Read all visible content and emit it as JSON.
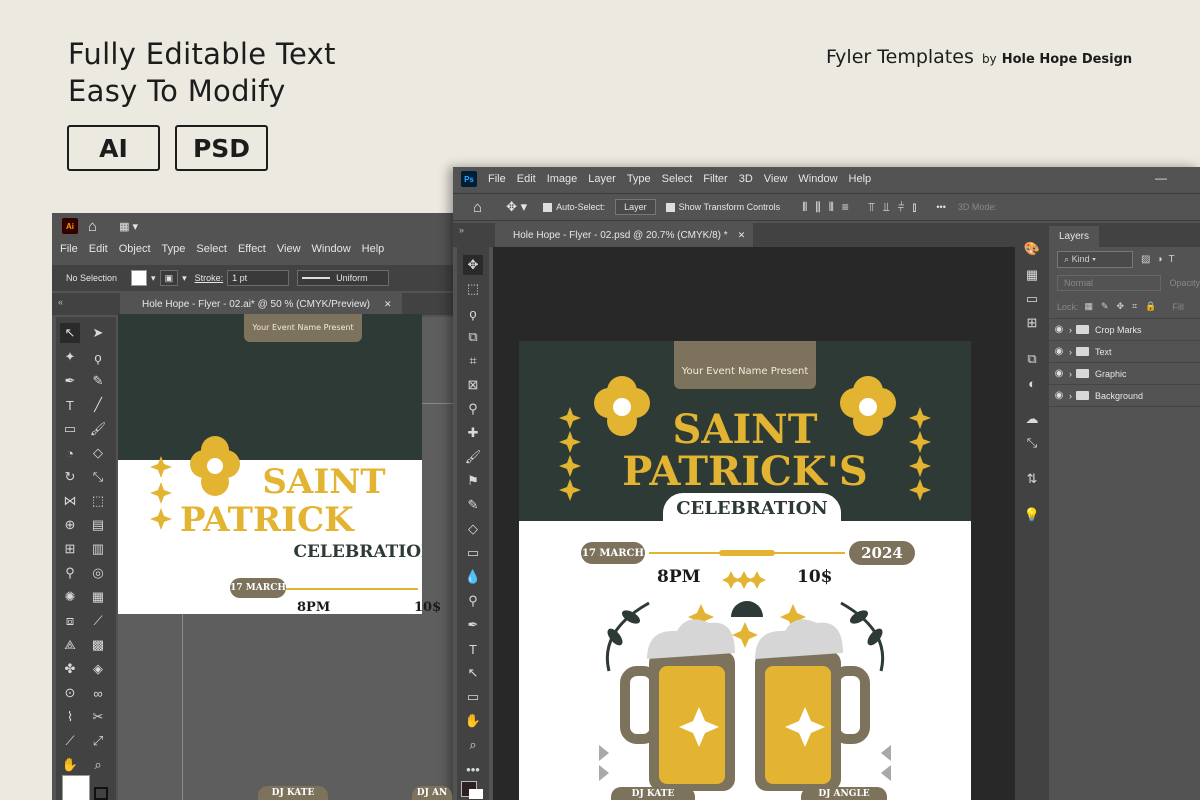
{
  "promo": {
    "line1": "Fully Editable Text",
    "line2": "Easy To Modify",
    "badge_ai": "AI",
    "badge_psd": "PSD",
    "brand_title": "Fyler Templates",
    "brand_by": "by",
    "brand_name": "Hole Hope Design"
  },
  "illustrator": {
    "app_badge": "Ai",
    "menu": [
      "File",
      "Edit",
      "Object",
      "Type",
      "Select",
      "Effect",
      "View",
      "Window",
      "Help"
    ],
    "selection": "No Selection",
    "stroke_label": "Stroke:",
    "stroke_value": "1 pt",
    "profile": "Uniform",
    "doc_tab": "Hole Hope - Flyer - 02.ai* @ 50 % (CMYK/Preview)",
    "close": "✕"
  },
  "photoshop": {
    "app_badge": "Ps",
    "menu": [
      "File",
      "Edit",
      "Image",
      "Layer",
      "Type",
      "Select",
      "Filter",
      "3D",
      "View",
      "Window",
      "Help"
    ],
    "auto_select": "Auto-Select:",
    "auto_select_target": "Layer",
    "transform": "Show Transform Controls",
    "mode_3d": "3D Mode:",
    "doc_tab": "Hole Hope - Flyer - 02.psd @ 20.7% (CMYK/8) *",
    "close": "✕",
    "panel_title": "Layers",
    "filter_kind": "Kind",
    "blend_mode": "Normal",
    "opacity_label": "Opacity",
    "lock_label": "Lock:",
    "fill_label": "Fill",
    "layers": [
      "Crop Marks",
      "Text",
      "Graphic",
      "Background"
    ]
  },
  "flyer": {
    "event_tag": "Your Event Name Present",
    "title1": "SAINT",
    "title2": "PATRICK'S",
    "title2_ai": "PATRICK",
    "subtitle": "CELEBRATION",
    "date": "17 MARCH",
    "year": "2024",
    "time": "8PM",
    "price": "10$",
    "dj1": "DJ KATE",
    "dj_ai_2": "DJ AN",
    "dj2": "DJ ANGLE"
  },
  "colors": {
    "dark": "#2d3a36",
    "gold": "#e3b431",
    "taupe": "#7d735d",
    "foam": "#d6d6d6"
  }
}
